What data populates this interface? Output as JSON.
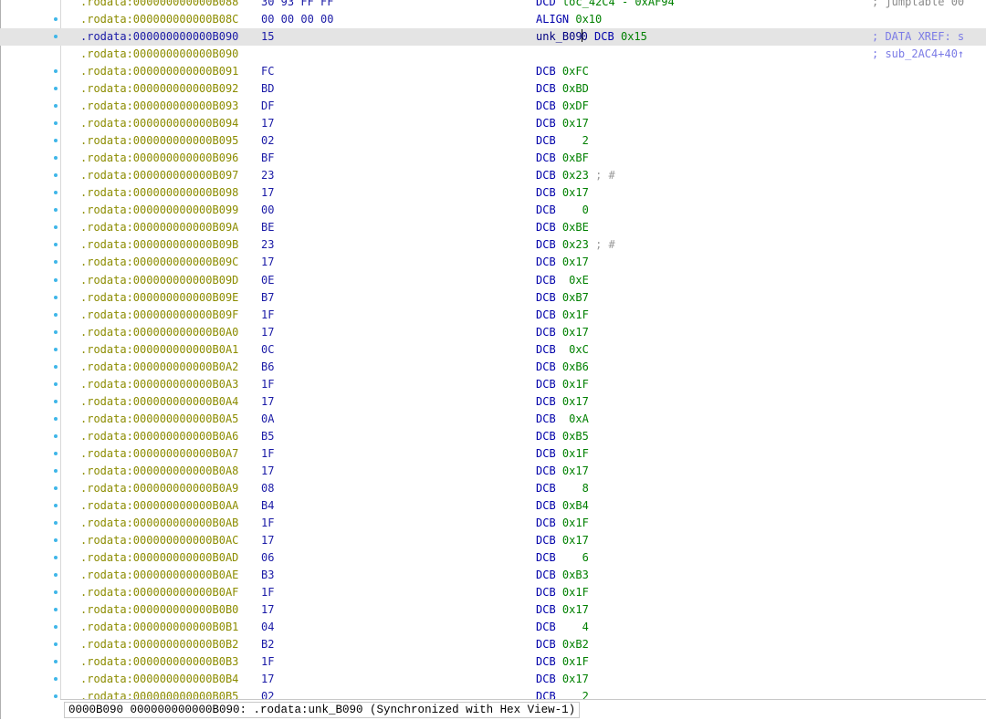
{
  "view": {
    "rows": [
      {
        "addr": ".rodata:000000000000B088",
        "bytes": "30 93 FF FF",
        "mnemonic": "DCD",
        "operand": "loc_42C4 - 0xAF94",
        "comment": "",
        "side": "; jumptable 00",
        "dot": false
      },
      {
        "addr": ".rodata:000000000000B08C",
        "bytes": "00 00 00 00",
        "mnemonic": "ALIGN",
        "operand": "0x10",
        "comment": "",
        "side": "",
        "dot": true
      },
      {
        "addr": ".rodata:000000000000B090",
        "bytes": "15",
        "label": "unk_B09",
        "label_tail": "0",
        "mnemonic": "DCB",
        "operand": "0x15",
        "comment": "",
        "side": "; DATA XREF: s",
        "dot": true,
        "selected": true
      },
      {
        "addr": ".rodata:000000000000B090",
        "bytes": "",
        "mnemonic": "",
        "operand": "",
        "comment": "",
        "side": "; sub_2AC4+40↑",
        "dot": false
      },
      {
        "addr": ".rodata:000000000000B091",
        "bytes": "FC",
        "mnemonic": "DCB",
        "operand": "0xFC",
        "comment": "",
        "side": "",
        "dot": true
      },
      {
        "addr": ".rodata:000000000000B092",
        "bytes": "BD",
        "mnemonic": "DCB",
        "operand": "0xBD",
        "comment": "",
        "side": "",
        "dot": true
      },
      {
        "addr": ".rodata:000000000000B093",
        "bytes": "DF",
        "mnemonic": "DCB",
        "operand": "0xDF",
        "comment": "",
        "side": "",
        "dot": true
      },
      {
        "addr": ".rodata:000000000000B094",
        "bytes": "17",
        "mnemonic": "DCB",
        "operand": "0x17",
        "comment": "",
        "side": "",
        "dot": true
      },
      {
        "addr": ".rodata:000000000000B095",
        "bytes": "02",
        "mnemonic": "DCB",
        "operand": "   2",
        "comment": "",
        "side": "",
        "dot": true
      },
      {
        "addr": ".rodata:000000000000B096",
        "bytes": "BF",
        "mnemonic": "DCB",
        "operand": "0xBF",
        "comment": "",
        "side": "",
        "dot": true
      },
      {
        "addr": ".rodata:000000000000B097",
        "bytes": "23",
        "mnemonic": "DCB",
        "operand": "0x23",
        "comment": "; #",
        "side": "",
        "dot": true
      },
      {
        "addr": ".rodata:000000000000B098",
        "bytes": "17",
        "mnemonic": "DCB",
        "operand": "0x17",
        "comment": "",
        "side": "",
        "dot": true
      },
      {
        "addr": ".rodata:000000000000B099",
        "bytes": "00",
        "mnemonic": "DCB",
        "operand": "   0",
        "comment": "",
        "side": "",
        "dot": true
      },
      {
        "addr": ".rodata:000000000000B09A",
        "bytes": "BE",
        "mnemonic": "DCB",
        "operand": "0xBE",
        "comment": "",
        "side": "",
        "dot": true
      },
      {
        "addr": ".rodata:000000000000B09B",
        "bytes": "23",
        "mnemonic": "DCB",
        "operand": "0x23",
        "comment": "; #",
        "side": "",
        "dot": true
      },
      {
        "addr": ".rodata:000000000000B09C",
        "bytes": "17",
        "mnemonic": "DCB",
        "operand": "0x17",
        "comment": "",
        "side": "",
        "dot": true
      },
      {
        "addr": ".rodata:000000000000B09D",
        "bytes": "0E",
        "mnemonic": "DCB",
        "operand": " 0xE",
        "comment": "",
        "side": "",
        "dot": true
      },
      {
        "addr": ".rodata:000000000000B09E",
        "bytes": "B7",
        "mnemonic": "DCB",
        "operand": "0xB7",
        "comment": "",
        "side": "",
        "dot": true
      },
      {
        "addr": ".rodata:000000000000B09F",
        "bytes": "1F",
        "mnemonic": "DCB",
        "operand": "0x1F",
        "comment": "",
        "side": "",
        "dot": true
      },
      {
        "addr": ".rodata:000000000000B0A0",
        "bytes": "17",
        "mnemonic": "DCB",
        "operand": "0x17",
        "comment": "",
        "side": "",
        "dot": true
      },
      {
        "addr": ".rodata:000000000000B0A1",
        "bytes": "0C",
        "mnemonic": "DCB",
        "operand": " 0xC",
        "comment": "",
        "side": "",
        "dot": true
      },
      {
        "addr": ".rodata:000000000000B0A2",
        "bytes": "B6",
        "mnemonic": "DCB",
        "operand": "0xB6",
        "comment": "",
        "side": "",
        "dot": true
      },
      {
        "addr": ".rodata:000000000000B0A3",
        "bytes": "1F",
        "mnemonic": "DCB",
        "operand": "0x1F",
        "comment": "",
        "side": "",
        "dot": true
      },
      {
        "addr": ".rodata:000000000000B0A4",
        "bytes": "17",
        "mnemonic": "DCB",
        "operand": "0x17",
        "comment": "",
        "side": "",
        "dot": true
      },
      {
        "addr": ".rodata:000000000000B0A5",
        "bytes": "0A",
        "mnemonic": "DCB",
        "operand": " 0xA",
        "comment": "",
        "side": "",
        "dot": true
      },
      {
        "addr": ".rodata:000000000000B0A6",
        "bytes": "B5",
        "mnemonic": "DCB",
        "operand": "0xB5",
        "comment": "",
        "side": "",
        "dot": true
      },
      {
        "addr": ".rodata:000000000000B0A7",
        "bytes": "1F",
        "mnemonic": "DCB",
        "operand": "0x1F",
        "comment": "",
        "side": "",
        "dot": true
      },
      {
        "addr": ".rodata:000000000000B0A8",
        "bytes": "17",
        "mnemonic": "DCB",
        "operand": "0x17",
        "comment": "",
        "side": "",
        "dot": true
      },
      {
        "addr": ".rodata:000000000000B0A9",
        "bytes": "08",
        "mnemonic": "DCB",
        "operand": "   8",
        "comment": "",
        "side": "",
        "dot": true
      },
      {
        "addr": ".rodata:000000000000B0AA",
        "bytes": "B4",
        "mnemonic": "DCB",
        "operand": "0xB4",
        "comment": "",
        "side": "",
        "dot": true
      },
      {
        "addr": ".rodata:000000000000B0AB",
        "bytes": "1F",
        "mnemonic": "DCB",
        "operand": "0x1F",
        "comment": "",
        "side": "",
        "dot": true
      },
      {
        "addr": ".rodata:000000000000B0AC",
        "bytes": "17",
        "mnemonic": "DCB",
        "operand": "0x17",
        "comment": "",
        "side": "",
        "dot": true
      },
      {
        "addr": ".rodata:000000000000B0AD",
        "bytes": "06",
        "mnemonic": "DCB",
        "operand": "   6",
        "comment": "",
        "side": "",
        "dot": true
      },
      {
        "addr": ".rodata:000000000000B0AE",
        "bytes": "B3",
        "mnemonic": "DCB",
        "operand": "0xB3",
        "comment": "",
        "side": "",
        "dot": true
      },
      {
        "addr": ".rodata:000000000000B0AF",
        "bytes": "1F",
        "mnemonic": "DCB",
        "operand": "0x1F",
        "comment": "",
        "side": "",
        "dot": true
      },
      {
        "addr": ".rodata:000000000000B0B0",
        "bytes": "17",
        "mnemonic": "DCB",
        "operand": "0x17",
        "comment": "",
        "side": "",
        "dot": true
      },
      {
        "addr": ".rodata:000000000000B0B1",
        "bytes": "04",
        "mnemonic": "DCB",
        "operand": "   4",
        "comment": "",
        "side": "",
        "dot": true
      },
      {
        "addr": ".rodata:000000000000B0B2",
        "bytes": "B2",
        "mnemonic": "DCB",
        "operand": "0xB2",
        "comment": "",
        "side": "",
        "dot": true
      },
      {
        "addr": ".rodata:000000000000B0B3",
        "bytes": "1F",
        "mnemonic": "DCB",
        "operand": "0x1F",
        "comment": "",
        "side": "",
        "dot": true
      },
      {
        "addr": ".rodata:000000000000B0B4",
        "bytes": "17",
        "mnemonic": "DCB",
        "operand": "0x17",
        "comment": "",
        "side": "",
        "dot": true
      },
      {
        "addr": ".rodata:000000000000B0B5",
        "bytes": "02",
        "mnemonic": "DCB",
        "operand": "   2",
        "comment": "",
        "side": "",
        "dot": true
      }
    ]
  },
  "status": {
    "text": "0000B090 000000000000B090: .rodata:unk_B090 (Synchronized with Hex View-1)"
  },
  "colors": {
    "address": "#8c8c00",
    "bytes": "#1a1aa6",
    "mnemonic": "#0000aa",
    "operand": "#008000",
    "xref_comment": "#7b7be6",
    "selected_row": "#e4e4e4",
    "breakpoint_dot": "#3fb6e8"
  }
}
